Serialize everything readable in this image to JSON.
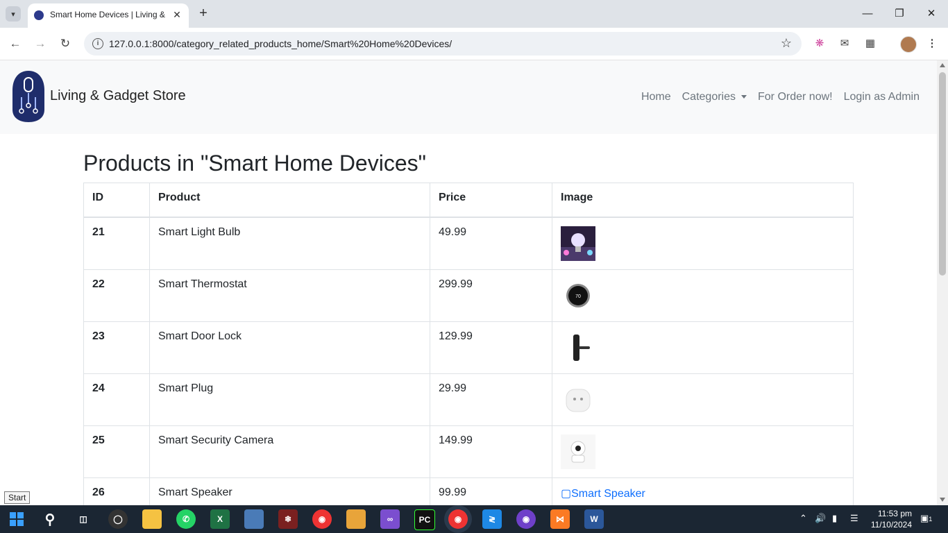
{
  "browser": {
    "tab_title": "Smart Home Devices | Living &",
    "url": "127.0.0.1:8000/category_related_products_home/Smart%20Home%20Devices/",
    "icons": [
      "tab-search-icon",
      "close-icon",
      "plus-icon",
      "minimize-icon",
      "restore-icon",
      "close-window-icon",
      "back-icon",
      "forward-icon",
      "reload-icon",
      "info-icon",
      "star-icon",
      "extension-icon",
      "mail-icon",
      "puzzle-icon",
      "avatar",
      "kebab-menu-icon"
    ]
  },
  "navbar": {
    "brand": "Living & Gadget Store",
    "links": {
      "home": "Home",
      "categories": "Categories",
      "order": "For Order now!",
      "admin": "Login as Admin"
    }
  },
  "main": {
    "heading": "Products in \"Smart Home Devices\"",
    "columns": [
      "ID",
      "Product",
      "Price",
      "Image"
    ],
    "rows": [
      {
        "id": "21",
        "product": "Smart Light Bulb",
        "price": "49.99",
        "image": "smart-light-bulb-image"
      },
      {
        "id": "22",
        "product": "Smart Thermostat",
        "price": "299.99",
        "image": "smart-thermostat-image"
      },
      {
        "id": "23",
        "product": "Smart Door Lock",
        "price": "129.99",
        "image": "smart-door-lock-image"
      },
      {
        "id": "24",
        "product": "Smart Plug",
        "price": "29.99",
        "image": "smart-plug-image"
      },
      {
        "id": "25",
        "product": "Smart Security Camera",
        "price": "149.99",
        "image": "smart-security-camera-image"
      },
      {
        "id": "26",
        "product": "Smart Speaker",
        "price": "99.99",
        "image_alt": "Smart Speaker"
      }
    ]
  },
  "tooltip": {
    "start": "Start"
  },
  "taskbar": {
    "time": "11:53 pm",
    "date": "11/10/2024",
    "notification_count": "1",
    "pinned_apps": [
      "windows-start",
      "search",
      "task-view",
      "obs",
      "file-explorer",
      "whatsapp",
      "excel",
      "storage",
      "aa-app",
      "chrome",
      "explorer-tool",
      "visual-studio",
      "pycharm",
      "chrome-active",
      "vscode",
      "github-desktop",
      "xampp",
      "word"
    ]
  }
}
